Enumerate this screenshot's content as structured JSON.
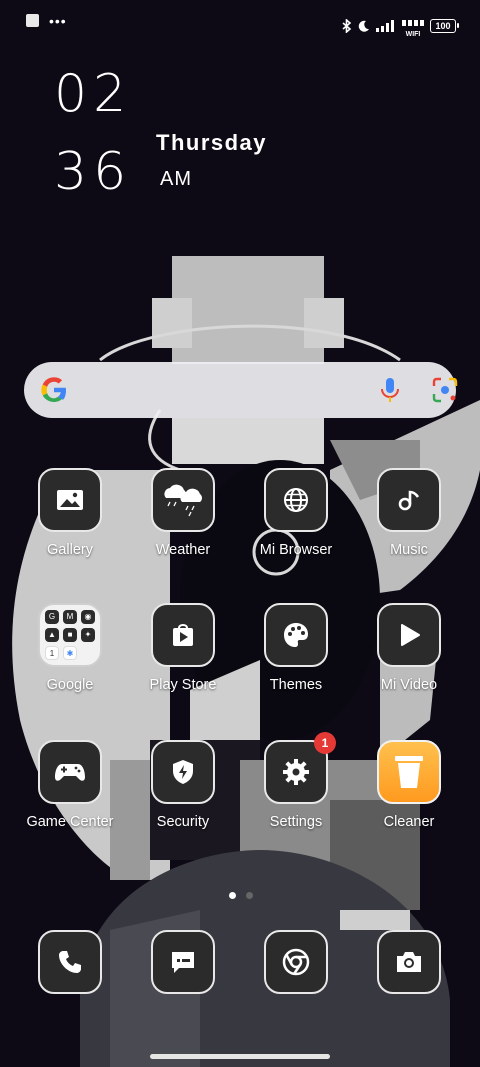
{
  "status_bar": {
    "left_icons": [
      "notification-square-icon",
      "more-dots-icon"
    ],
    "more_text": "•••",
    "right_icons": [
      "bluetooth-icon",
      "do-not-disturb-moon-icon",
      "signal-icon",
      "wifi-icon",
      "battery-icon"
    ],
    "wifi_label": "WIFI",
    "battery": "100"
  },
  "clock": {
    "hour": "02",
    "minute": "36",
    "day": "Thursday",
    "ampm": "AM"
  },
  "search": {
    "icons": [
      "google-g-icon",
      "microphone-icon",
      "google-lens-icon"
    ]
  },
  "apps": {
    "gallery": "Gallery",
    "weather": "Weather",
    "browser": "Mi Browser",
    "music": "Music",
    "google": "Google",
    "playstore": "Play Store",
    "themes": "Themes",
    "mivideo": "Mi Video",
    "gamecenter": "Game Center",
    "security": "Security",
    "settings": "Settings",
    "settings_badge": "1",
    "cleaner": "Cleaner"
  },
  "google_folder": [
    "G",
    "M",
    "◉",
    "▲",
    "■",
    "✦",
    "1",
    "✱"
  ],
  "dock": [
    "phone-icon",
    "messages-icon",
    "chrome-icon",
    "camera-icon"
  ],
  "page_indicator": {
    "pages": 2,
    "current": 1
  },
  "colors": {
    "background": "#0d0a16",
    "icon_tile": "#2b2b2b",
    "icon_border": "#e8e8e8",
    "badge": "#e53935",
    "cleaner": "#ffa726"
  }
}
